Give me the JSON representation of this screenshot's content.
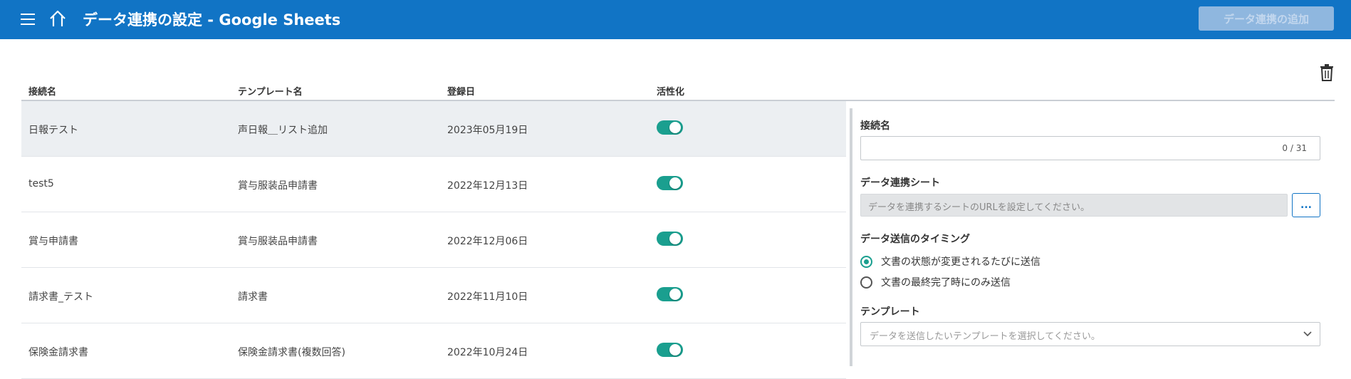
{
  "header": {
    "title": "データ連携の設定 - Google Sheets",
    "add_button_label": "データ連携の追加",
    "menu_icon": "menu-icon",
    "home_icon": "home-icon",
    "bg_color": "#1174c5"
  },
  "table": {
    "columns": [
      "接続名",
      "テンプレート名",
      "登録日",
      "活性化"
    ],
    "rows": [
      {
        "name": "日報テスト",
        "template": "声日報＿リスト追加",
        "date": "2023年05月19日",
        "active": true
      },
      {
        "name": "test5",
        "template": "賞与服装品申請書",
        "date": "2022年12月13日",
        "active": true
      },
      {
        "name": "賞与申請書",
        "template": "賞与服装品申請書",
        "date": "2022年12月06日",
        "active": true
      },
      {
        "name": "請求書_テスト",
        "template": "請求書",
        "date": "2022年11月10日",
        "active": true
      },
      {
        "name": "保険金請求書",
        "template": "保険金請求書(複数回答)",
        "date": "2022年10月24日",
        "active": true
      }
    ]
  },
  "panel": {
    "connection_name_label": "接続名",
    "connection_name_value": "",
    "connection_name_counter": "0 / 31",
    "sheet_label": "データ連携シート",
    "sheet_placeholder": "データを連携するシートのURLを設定してください。",
    "browse_label": "...",
    "timing_label": "データ送信のタイミング",
    "timing_options": [
      "文書の状態が変更されるたびに送信",
      "文書の最終完了時にのみ送信"
    ],
    "timing_selected": 0,
    "template_label": "テンプレート",
    "template_placeholder": "データを送信したいテンプレートを選択してください。"
  },
  "colors": {
    "accent": "#1a9f8f",
    "brand": "#1174c5"
  }
}
